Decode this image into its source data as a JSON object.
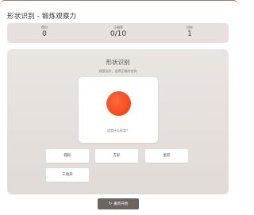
{
  "header": {
    "title": "形状识别 - 锻炼观察力"
  },
  "stats": [
    {
      "label": "得分",
      "value": "0"
    },
    {
      "label": "正确率",
      "value": "0/10"
    },
    {
      "label": "回合",
      "value": "1"
    }
  ],
  "game": {
    "title": "形状识别",
    "subtitle": "观察形状，选择正确的名称",
    "question": "这是什么形状？",
    "shape": {
      "type": "circle",
      "color": "#f4511e"
    },
    "options": [
      "圆形",
      "方形",
      "星形",
      "三角形"
    ]
  },
  "controls": {
    "restart_label": "重新开始",
    "restart_icon": "refresh-icon"
  }
}
